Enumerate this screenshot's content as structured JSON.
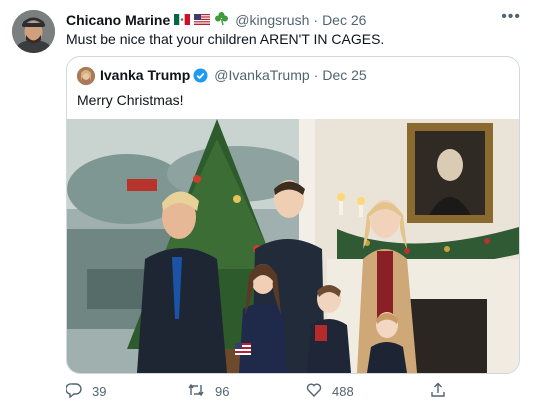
{
  "tweet": {
    "author_name": "Chicano Marine",
    "author_handle": "@kingsrush",
    "separator": "·",
    "date": "Dec 26",
    "text": "Must be nice that your children AREN'T IN CAGES.",
    "more_label": "•••"
  },
  "quoted": {
    "author_name": "Ivanka Trump",
    "author_handle": "@IvankaTrump",
    "separator": "·",
    "date": "Dec 25",
    "text": "Merry Christmas!"
  },
  "actions": {
    "reply_count": "39",
    "retweet_count": "96",
    "like_count": "488"
  },
  "colors": {
    "text_primary": "#0f1419",
    "text_secondary": "#536471",
    "border": "#cfd9de",
    "verified": "#1d9bf0"
  },
  "icons": [
    "mexico-flag-icon",
    "us-flag-icon",
    "shamrock-icon",
    "verified-badge-icon",
    "reply-icon",
    "retweet-icon",
    "like-icon",
    "share-icon"
  ]
}
